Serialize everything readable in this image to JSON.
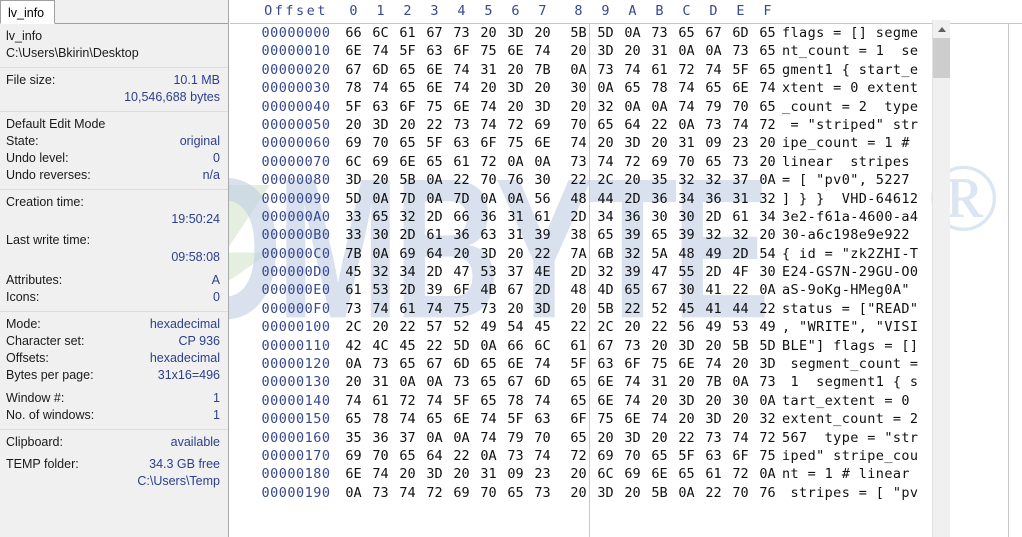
{
  "tab": {
    "label": "lv_info"
  },
  "info": {
    "file_name": "lv_info",
    "file_path": "C:\\Users\\Bkirin\\Desktop",
    "file_size_label": "File size:",
    "file_size_value": "10.1 MB",
    "file_size_bytes": "10,546,688 bytes",
    "edit_mode_title": "Default Edit Mode",
    "state_label": "State:",
    "state_value": "original",
    "undo_level_label": "Undo level:",
    "undo_level_value": "0",
    "undo_reverses_label": "Undo reverses:",
    "undo_reverses_value": "n/a",
    "creation_time_label": "Creation time:",
    "creation_time_date": "",
    "creation_time_value": "19:50:24",
    "last_write_time_label": "Last write time:",
    "last_write_time_date": "",
    "last_write_time_value": "09:58:08",
    "attributes_label": "Attributes:",
    "attributes_value": "A",
    "icons_label": "Icons:",
    "icons_value": "0",
    "mode_label": "Mode:",
    "mode_value": "hexadecimal",
    "charset_label": "Character set:",
    "charset_value": "CP 936",
    "offsets_label": "Offsets:",
    "offsets_value": "hexadecimal",
    "bytes_per_page_label": "Bytes per page:",
    "bytes_per_page_value": "31x16=496",
    "window_num_label": "Window #:",
    "window_num_value": "1",
    "no_windows_label": "No. of windows:",
    "no_windows_value": "1",
    "clipboard_label": "Clipboard:",
    "clipboard_value": "available",
    "temp_folder_label": "TEMP folder:",
    "temp_folder_value": "34.3 GB free",
    "temp_folder_path": "C:\\Users\\Temp"
  },
  "hex": {
    "offset_header": "Offset",
    "columns": [
      "0",
      "1",
      "2",
      "3",
      "4",
      "5",
      "6",
      "7",
      "8",
      "9",
      "A",
      "B",
      "C",
      "D",
      "E",
      "F"
    ],
    "rows": [
      {
        "offset": "00000000",
        "bytes": [
          "66",
          "6C",
          "61",
          "67",
          "73",
          "20",
          "3D",
          "20",
          "5B",
          "5D",
          "0A",
          "73",
          "65",
          "67",
          "6D",
          "65"
        ],
        "ascii": "flags = [] segme"
      },
      {
        "offset": "00000010",
        "bytes": [
          "6E",
          "74",
          "5F",
          "63",
          "6F",
          "75",
          "6E",
          "74",
          "20",
          "3D",
          "20",
          "31",
          "0A",
          "0A",
          "73",
          "65"
        ],
        "ascii": "nt_count = 1  se"
      },
      {
        "offset": "00000020",
        "bytes": [
          "67",
          "6D",
          "65",
          "6E",
          "74",
          "31",
          "20",
          "7B",
          "0A",
          "73",
          "74",
          "61",
          "72",
          "74",
          "5F",
          "65"
        ],
        "ascii": "gment1 { start_e"
      },
      {
        "offset": "00000030",
        "bytes": [
          "78",
          "74",
          "65",
          "6E",
          "74",
          "20",
          "3D",
          "20",
          "30",
          "0A",
          "65",
          "78",
          "74",
          "65",
          "6E",
          "74"
        ],
        "ascii": "xtent = 0 extent"
      },
      {
        "offset": "00000040",
        "bytes": [
          "5F",
          "63",
          "6F",
          "75",
          "6E",
          "74",
          "20",
          "3D",
          "20",
          "32",
          "0A",
          "0A",
          "74",
          "79",
          "70",
          "65"
        ],
        "ascii": "_count = 2  type"
      },
      {
        "offset": "00000050",
        "bytes": [
          "20",
          "3D",
          "20",
          "22",
          "73",
          "74",
          "72",
          "69",
          "70",
          "65",
          "64",
          "22",
          "0A",
          "73",
          "74",
          "72"
        ],
        "ascii": " = \"striped\" str"
      },
      {
        "offset": "00000060",
        "bytes": [
          "69",
          "70",
          "65",
          "5F",
          "63",
          "6F",
          "75",
          "6E",
          "74",
          "20",
          "3D",
          "20",
          "31",
          "09",
          "23",
          "20"
        ],
        "ascii": "ipe_count = 1 # "
      },
      {
        "offset": "00000070",
        "bytes": [
          "6C",
          "69",
          "6E",
          "65",
          "61",
          "72",
          "0A",
          "0A",
          "73",
          "74",
          "72",
          "69",
          "70",
          "65",
          "73",
          "20"
        ],
        "ascii": "linear  stripes "
      },
      {
        "offset": "00000080",
        "bytes": [
          "3D",
          "20",
          "5B",
          "0A",
          "22",
          "70",
          "76",
          "30",
          "22",
          "2C",
          "20",
          "35",
          "32",
          "32",
          "37",
          "0A"
        ],
        "ascii": "= [ \"pv0\", 5227 "
      },
      {
        "offset": "00000090",
        "bytes": [
          "5D",
          "0A",
          "7D",
          "0A",
          "7D",
          "0A",
          "0A",
          "56",
          "48",
          "44",
          "2D",
          "36",
          "34",
          "36",
          "31",
          "32"
        ],
        "ascii": "] } }  VHD-64612"
      },
      {
        "offset": "000000A0",
        "bytes": [
          "33",
          "65",
          "32",
          "2D",
          "66",
          "36",
          "31",
          "61",
          "2D",
          "34",
          "36",
          "30",
          "30",
          "2D",
          "61",
          "34"
        ],
        "ascii": "3e2-f61a-4600-a4"
      },
      {
        "offset": "000000B0",
        "bytes": [
          "33",
          "30",
          "2D",
          "61",
          "36",
          "63",
          "31",
          "39",
          "38",
          "65",
          "39",
          "65",
          "39",
          "32",
          "32",
          "20"
        ],
        "ascii": "30-a6c198e9e922 "
      },
      {
        "offset": "000000C0",
        "bytes": [
          "7B",
          "0A",
          "69",
          "64",
          "20",
          "3D",
          "20",
          "22",
          "7A",
          "6B",
          "32",
          "5A",
          "48",
          "49",
          "2D",
          "54"
        ],
        "ascii": "{ id = \"zk2ZHI-T"
      },
      {
        "offset": "000000D0",
        "bytes": [
          "45",
          "32",
          "34",
          "2D",
          "47",
          "53",
          "37",
          "4E",
          "2D",
          "32",
          "39",
          "47",
          "55",
          "2D",
          "4F",
          "30"
        ],
        "ascii": "E24-GS7N-29GU-O0"
      },
      {
        "offset": "000000E0",
        "bytes": [
          "61",
          "53",
          "2D",
          "39",
          "6F",
          "4B",
          "67",
          "2D",
          "48",
          "4D",
          "65",
          "67",
          "30",
          "41",
          "22",
          "0A"
        ],
        "ascii": "aS-9oKg-HMeg0A\""
      },
      {
        "offset": "000000F0",
        "bytes": [
          "73",
          "74",
          "61",
          "74",
          "75",
          "73",
          "20",
          "3D",
          "20",
          "5B",
          "22",
          "52",
          "45",
          "41",
          "44",
          "22"
        ],
        "ascii": "status = [\"READ\""
      },
      {
        "offset": "00000100",
        "bytes": [
          "2C",
          "20",
          "22",
          "57",
          "52",
          "49",
          "54",
          "45",
          "22",
          "2C",
          "20",
          "22",
          "56",
          "49",
          "53",
          "49"
        ],
        "ascii": ", \"WRITE\", \"VISI"
      },
      {
        "offset": "00000110",
        "bytes": [
          "42",
          "4C",
          "45",
          "22",
          "5D",
          "0A",
          "66",
          "6C",
          "61",
          "67",
          "73",
          "20",
          "3D",
          "20",
          "5B",
          "5D"
        ],
        "ascii": "BLE\"] flags = []"
      },
      {
        "offset": "00000120",
        "bytes": [
          "0A",
          "73",
          "65",
          "67",
          "6D",
          "65",
          "6E",
          "74",
          "5F",
          "63",
          "6F",
          "75",
          "6E",
          "74",
          "20",
          "3D"
        ],
        "ascii": " segment_count ="
      },
      {
        "offset": "00000130",
        "bytes": [
          "20",
          "31",
          "0A",
          "0A",
          "73",
          "65",
          "67",
          "6D",
          "65",
          "6E",
          "74",
          "31",
          "20",
          "7B",
          "0A",
          "73"
        ],
        "ascii": " 1  segment1 { s"
      },
      {
        "offset": "00000140",
        "bytes": [
          "74",
          "61",
          "72",
          "74",
          "5F",
          "65",
          "78",
          "74",
          "65",
          "6E",
          "74",
          "20",
          "3D",
          "20",
          "30",
          "0A"
        ],
        "ascii": "tart_extent = 0 "
      },
      {
        "offset": "00000150",
        "bytes": [
          "65",
          "78",
          "74",
          "65",
          "6E",
          "74",
          "5F",
          "63",
          "6F",
          "75",
          "6E",
          "74",
          "20",
          "3D",
          "20",
          "32"
        ],
        "ascii": "extent_count = 2"
      },
      {
        "offset": "00000160",
        "bytes": [
          "35",
          "36",
          "37",
          "0A",
          "0A",
          "74",
          "79",
          "70",
          "65",
          "20",
          "3D",
          "20",
          "22",
          "73",
          "74",
          "72"
        ],
        "ascii": "567  type = \"str"
      },
      {
        "offset": "00000170",
        "bytes": [
          "69",
          "70",
          "65",
          "64",
          "22",
          "0A",
          "73",
          "74",
          "72",
          "69",
          "70",
          "65",
          "5F",
          "63",
          "6F",
          "75"
        ],
        "ascii": "iped\" stripe_cou"
      },
      {
        "offset": "00000180",
        "bytes": [
          "6E",
          "74",
          "20",
          "3D",
          "20",
          "31",
          "09",
          "23",
          "20",
          "6C",
          "69",
          "6E",
          "65",
          "61",
          "72",
          "0A"
        ],
        "ascii": "nt = 1 # linear "
      },
      {
        "offset": "00000190",
        "bytes": [
          "0A",
          "73",
          "74",
          "72",
          "69",
          "70",
          "65",
          "73",
          "20",
          "3D",
          "20",
          "5B",
          "0A",
          "22",
          "70",
          "76"
        ],
        "ascii": " stripes = [ \"pv"
      }
    ]
  },
  "watermark": {
    "text": "FROMBYTE",
    "registered": "®"
  },
  "colors": {
    "offset_text": "#36488f",
    "header_text": "#36488f",
    "value_text": "#2b3f8c",
    "pane_bg": "#f0f0f0"
  }
}
